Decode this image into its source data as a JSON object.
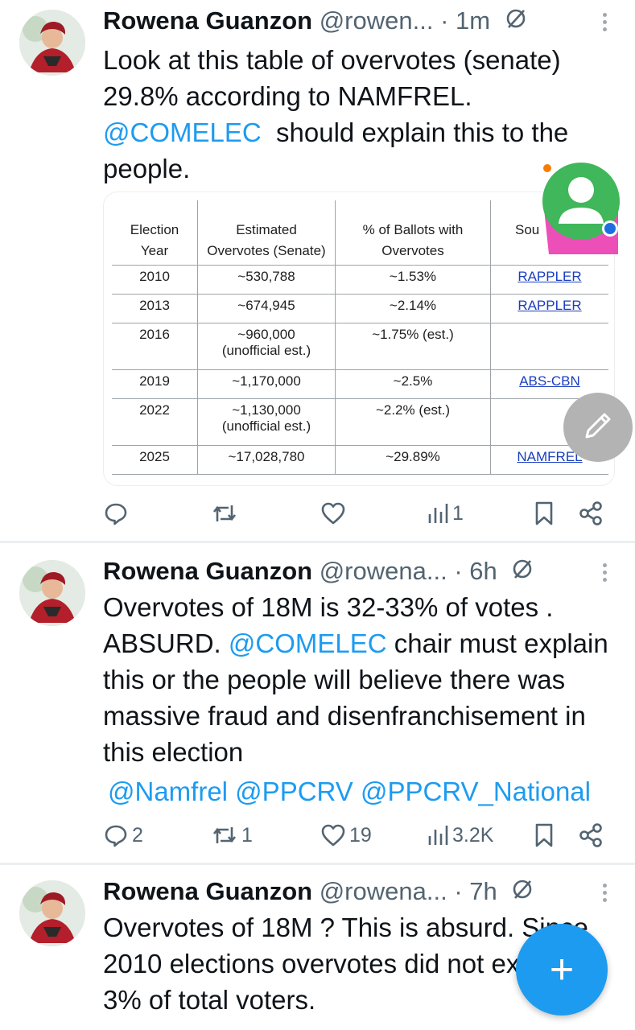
{
  "tweets": [
    {
      "name": "Rowena Guanzon",
      "handle": "@rowen...",
      "time": "· 1m",
      "text_lines": [
        "Look at this table of overvotes (senate)",
        "29.8% according to NAMFREL.",
        {
          "mention": "@COMELEC",
          "rest": "  should explain this to the"
        },
        "people."
      ],
      "table": {
        "headers": [
          [
            "Election",
            "Year"
          ],
          [
            "Estimated",
            "Overvotes (Senate)"
          ],
          [
            "% of Ballots with",
            "Overvotes"
          ],
          [
            "Sou"
          ]
        ],
        "rows": [
          {
            "year": "2010",
            "overvotes": [
              "~530,788"
            ],
            "pct": "~1.53%",
            "source": "RAPPLER"
          },
          {
            "year": "2013",
            "overvotes": [
              "~674,945"
            ],
            "pct": "~2.14%",
            "source": "RAPPLER"
          },
          {
            "year": "2016",
            "overvotes": [
              "~960,000",
              "(unofficial est.)"
            ],
            "pct": "~1.75% (est.)",
            "source": ""
          },
          {
            "year": "2019",
            "overvotes": [
              "~1,170,000"
            ],
            "pct": "~2.5%",
            "source": "ABS-CBN"
          },
          {
            "year": "2022",
            "overvotes": [
              "~1,130,000",
              "(unofficial est.)"
            ],
            "pct": "~2.2% (est.)",
            "source": ""
          },
          {
            "year": "2025",
            "overvotes": [
              "~17,028,780"
            ],
            "pct": "~29.89%",
            "source": "NAMFREL"
          }
        ]
      },
      "stats": {
        "replies": "",
        "reposts": "",
        "likes": "",
        "views": "1"
      }
    },
    {
      "name": "Rowena Guanzon",
      "handle": "@rowena...",
      "time": "· 6h",
      "text_lines": [
        "Overvotes of 18M is 32-33% of votes .",
        {
          "pre": "ABSURD. ",
          "mention": "@COMELEC",
          "rest": " chair must explain"
        },
        "this or the people will believe there was",
        "massive fraud and disenfranchisement in",
        "this election"
      ],
      "mentions_line": "@Namfrel @PPCRV @PPCRV_National",
      "stats": {
        "replies": "2",
        "reposts": "1",
        "likes": "19",
        "views": "3.2K"
      }
    },
    {
      "name": "Rowena Guanzon",
      "handle": "@rowena...",
      "time": "· 7h",
      "text_lines": [
        "Overvotes of 18M ? This is absurd. Since",
        "2010 elections overvotes did not exceed",
        "3% of total voters."
      ]
    }
  ],
  "icons": {
    "reply": "reply-icon",
    "repost": "repost-icon",
    "like": "heart-icon",
    "views": "views-icon",
    "bookmark": "bookmark-icon",
    "share": "share-icon",
    "grok": "grok-icon",
    "more": "more-icon",
    "edit": "pencil-icon",
    "compose": "plus-icon"
  },
  "fab": {
    "compose_label": "+"
  },
  "colors": {
    "accent": "#1d9bf0",
    "text": "#0f1419",
    "muted": "#536471",
    "fab_gray": "#b3b3b3"
  }
}
